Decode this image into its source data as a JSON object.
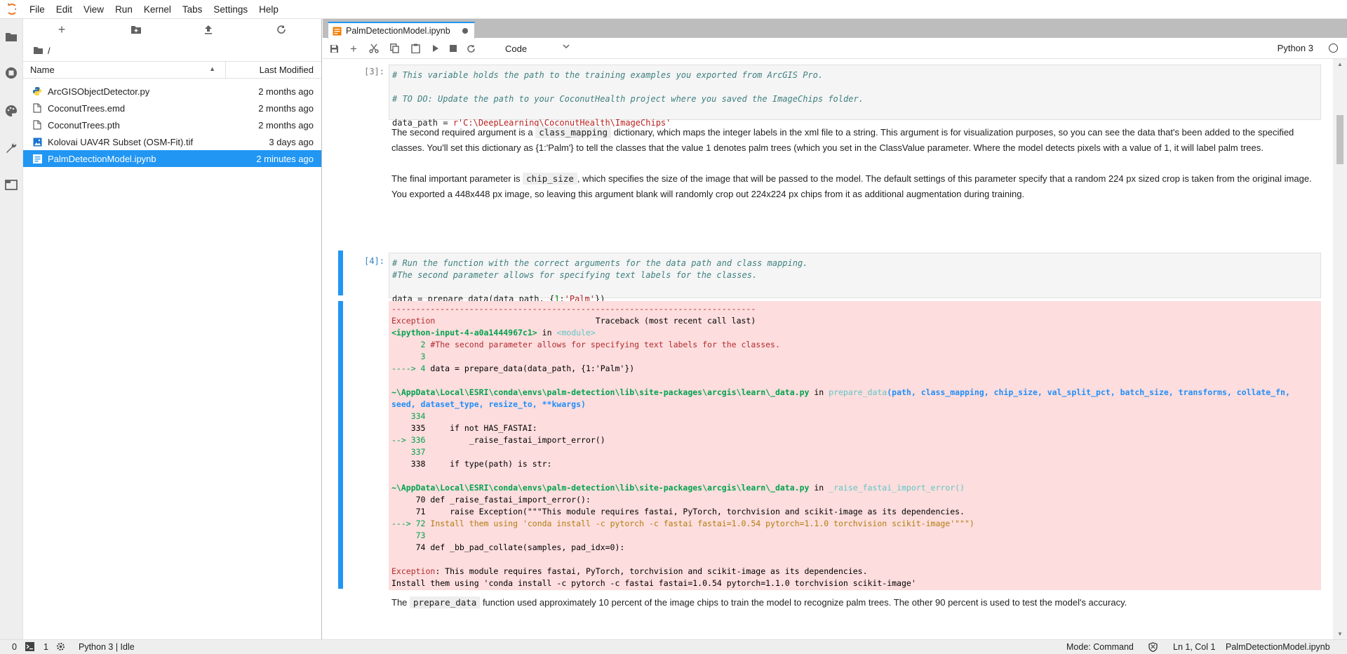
{
  "menubar": {
    "items": [
      "File",
      "Edit",
      "View",
      "Run",
      "Kernel",
      "Tabs",
      "Settings",
      "Help"
    ]
  },
  "activity_bar": {
    "icons": [
      "folder-icon",
      "running-icon",
      "palette-icon",
      "wrench-icon",
      "tabs-icon"
    ]
  },
  "file_browser": {
    "breadcrumb": "/",
    "columns": {
      "name": "Name",
      "modified": "Last Modified"
    },
    "files": [
      {
        "name": "ArcGISObjectDetector.py",
        "modified": "2 months ago",
        "icon": "python-file-icon"
      },
      {
        "name": "CoconutTrees.emd",
        "modified": "2 months ago",
        "icon": "file-icon"
      },
      {
        "name": "CoconutTrees.pth",
        "modified": "2 months ago",
        "icon": "file-icon"
      },
      {
        "name": "Kolovai UAV4R Subset (OSM-Fit).tif",
        "modified": "3 days ago",
        "icon": "image-file-icon"
      },
      {
        "name": "PalmDetectionModel.ipynb",
        "modified": "2 minutes ago",
        "icon": "notebook-file-icon",
        "selected": true
      }
    ]
  },
  "tab": {
    "title": "PalmDetectionModel.ipynb"
  },
  "toolbar": {
    "cell_type": "Code",
    "kernel": "Python 3"
  },
  "cells": {
    "cell3": {
      "prompt": "[3]:",
      "line1": "# This variable holds the path to the training examples you exported from ArcGIS Pro.",
      "line2": "# TO DO: Update the path to your CoconutHealth project where you saved the ImageChips folder.",
      "line3_var": "data_path = ",
      "line3_str": "r'C:\\DeepLearning\\CoconutHealth\\ImageChips'"
    },
    "md1": {
      "before": "The second required argument is a ",
      "code": "class_mapping",
      "after": " dictionary, which maps the integer labels in the xml file to a string. This argument is for visualization purposes, so you can see the data that's been added to the specified classes. You'll set this dictionary as {1:'Palm'} to tell the classes that the value 1 denotes palm trees (which you set in the ClassValue parameter. Where the model detects pixels with a value of 1, it will label palm trees."
    },
    "md2": {
      "before": "The final important parameter is ",
      "code": "chip_size",
      "after": ", which specifies the size of the image that will be passed to the model. The default settings of this parameter specify that a random 224 px sized crop is taken from the original image. You exported a 448x448 px image, so leaving this argument blank will randomly crop out 224x224 px chips from it as additional augmentation during training."
    },
    "cell4": {
      "prompt": "[4]:",
      "line1": "# Run the function with the correct arguments for the data path and class mapping.",
      "line2": "#The second parameter allows for specifying text labels for the classes.",
      "line3_a": "data = prepare_data(data_path, {",
      "line3_num": "1",
      "line3_b": ":",
      "line3_str": "'Palm'",
      "line3_c": "})"
    },
    "output": {
      "dashes": "---------------------------------------------------------------------------",
      "exc_name": "Exception",
      "exc_tb": "                                 Traceback (most recent call last)",
      "input_ref": "<ipython-input-4-a0a1444967c1>",
      "in_word": " in ",
      "module": "<module>",
      "l2": "      2 ",
      "l2_text": "#The second parameter allows for specifying text labels for the classes.",
      "l3": "      3",
      "l4_arrow": "----> 4 ",
      "l4_text": "data = prepare_data(data_path, {1:'Palm'})",
      "path1": "~\\AppData\\Local\\ESRI\\conda\\envs\\palm-detection\\lib\\site-packages\\arcgis\\learn\\_data.py",
      "fn1": "prepare_data",
      "args1": "(path, class_mapping, chip_size, val_split_pct, batch_size, transforms, collate_fn,",
      "args1b": "seed, dataset_type, resize_to, **kwargs)",
      "a334": "    334",
      "a335": "    335     if not HAS_FASTAI:",
      "a336_arrow": "--> 336 ",
      "a336_text": "        _raise_fastai_import_error()",
      "a337": "    337",
      "a338": "    338     if type(path) is str:",
      "fn2": "_raise_fastai_import_error()",
      "b70": "     70 def _raise_fastai_import_error():",
      "b71": "     71     raise Exception(\"\"\"This module requires fastai, PyTorch, torchvision and scikit-image as its dependencies.",
      "b72_arrow": "---> 72 ",
      "b72_text": "Install them using 'conda install -c pytorch -c fastai fastai=1.0.54 pytorch=1.1.0 torchvision scikit-image'\"\"\")",
      "b73": "     73",
      "b74": "     74 def _bb_pad_collate(samples, pad_idx=0):",
      "final_name": "Exception",
      "final_msg": ": This module requires fastai, PyTorch, torchvision and scikit-image as its dependencies.",
      "final_msg2": "Install them using 'conda install -c pytorch -c fastai fastai=1.0.54 pytorch=1.1.0 torchvision scikit-image'"
    },
    "md3": {
      "before": "The ",
      "code": "prepare_data",
      "after": " function used approximately 10 percent of the image chips to train the model to recognize palm trees. The other 90 percent is used to test the model's accuracy."
    }
  },
  "statusbar": {
    "count0": "0",
    "count1": "1",
    "kernel_status": "Python 3 | Idle",
    "mode": "Mode: Command",
    "position": "Ln 1, Col 1",
    "file": "PalmDetectionModel.ipynb"
  }
}
